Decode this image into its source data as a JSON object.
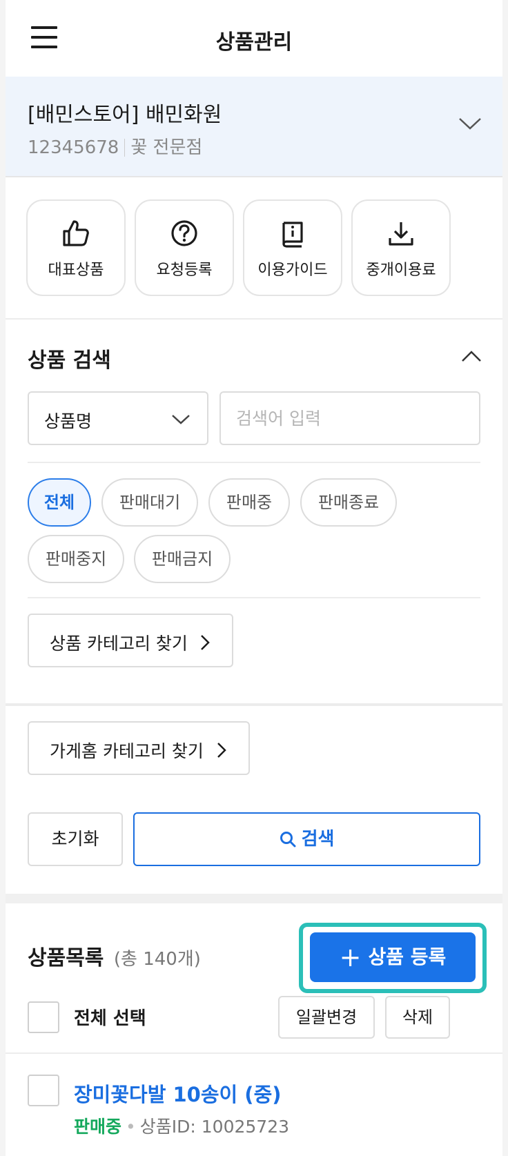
{
  "header": {
    "title": "상품관리",
    "menu_icon": "hamburger-icon"
  },
  "store": {
    "name": "[배민스토어] 배민화원",
    "id": "12345678",
    "category": "꽃 전문점"
  },
  "quick_menu": [
    {
      "label": "대표상품",
      "icon": "thumbs-up-icon"
    },
    {
      "label": "요청등록",
      "icon": "question-circle-icon"
    },
    {
      "label": "이용가이드",
      "icon": "guide-book-icon"
    },
    {
      "label": "중개이용료",
      "icon": "download-icon"
    }
  ],
  "search": {
    "title": "상품 검색",
    "field_select": "상품명",
    "placeholder": "검색어 입력",
    "status_chips": [
      "전체",
      "판매대기",
      "판매중",
      "판매종료",
      "판매중지",
      "판매금지"
    ],
    "active_chip": "전체",
    "category_button": "상품 카테고리 찾기",
    "home_category_button": "가게홈 카테고리 찾기",
    "reset_label": "초기화",
    "search_label": "검색"
  },
  "list": {
    "title": "상품목록",
    "count_text": "(총 140개)",
    "add_label": "상품 등록",
    "select_all": "전체 선택",
    "bulk_edit": "일괄변경",
    "delete": "삭제"
  },
  "products": [
    {
      "name": "장미꽃다발 10송이 (중)",
      "status": "판매중",
      "id_text": "상품ID: 10025723"
    }
  ],
  "colors": {
    "accent": "#1a73e8",
    "highlight": "#2bbfb8",
    "status_green": "#14a85c",
    "store_bg": "#eef4fc"
  }
}
